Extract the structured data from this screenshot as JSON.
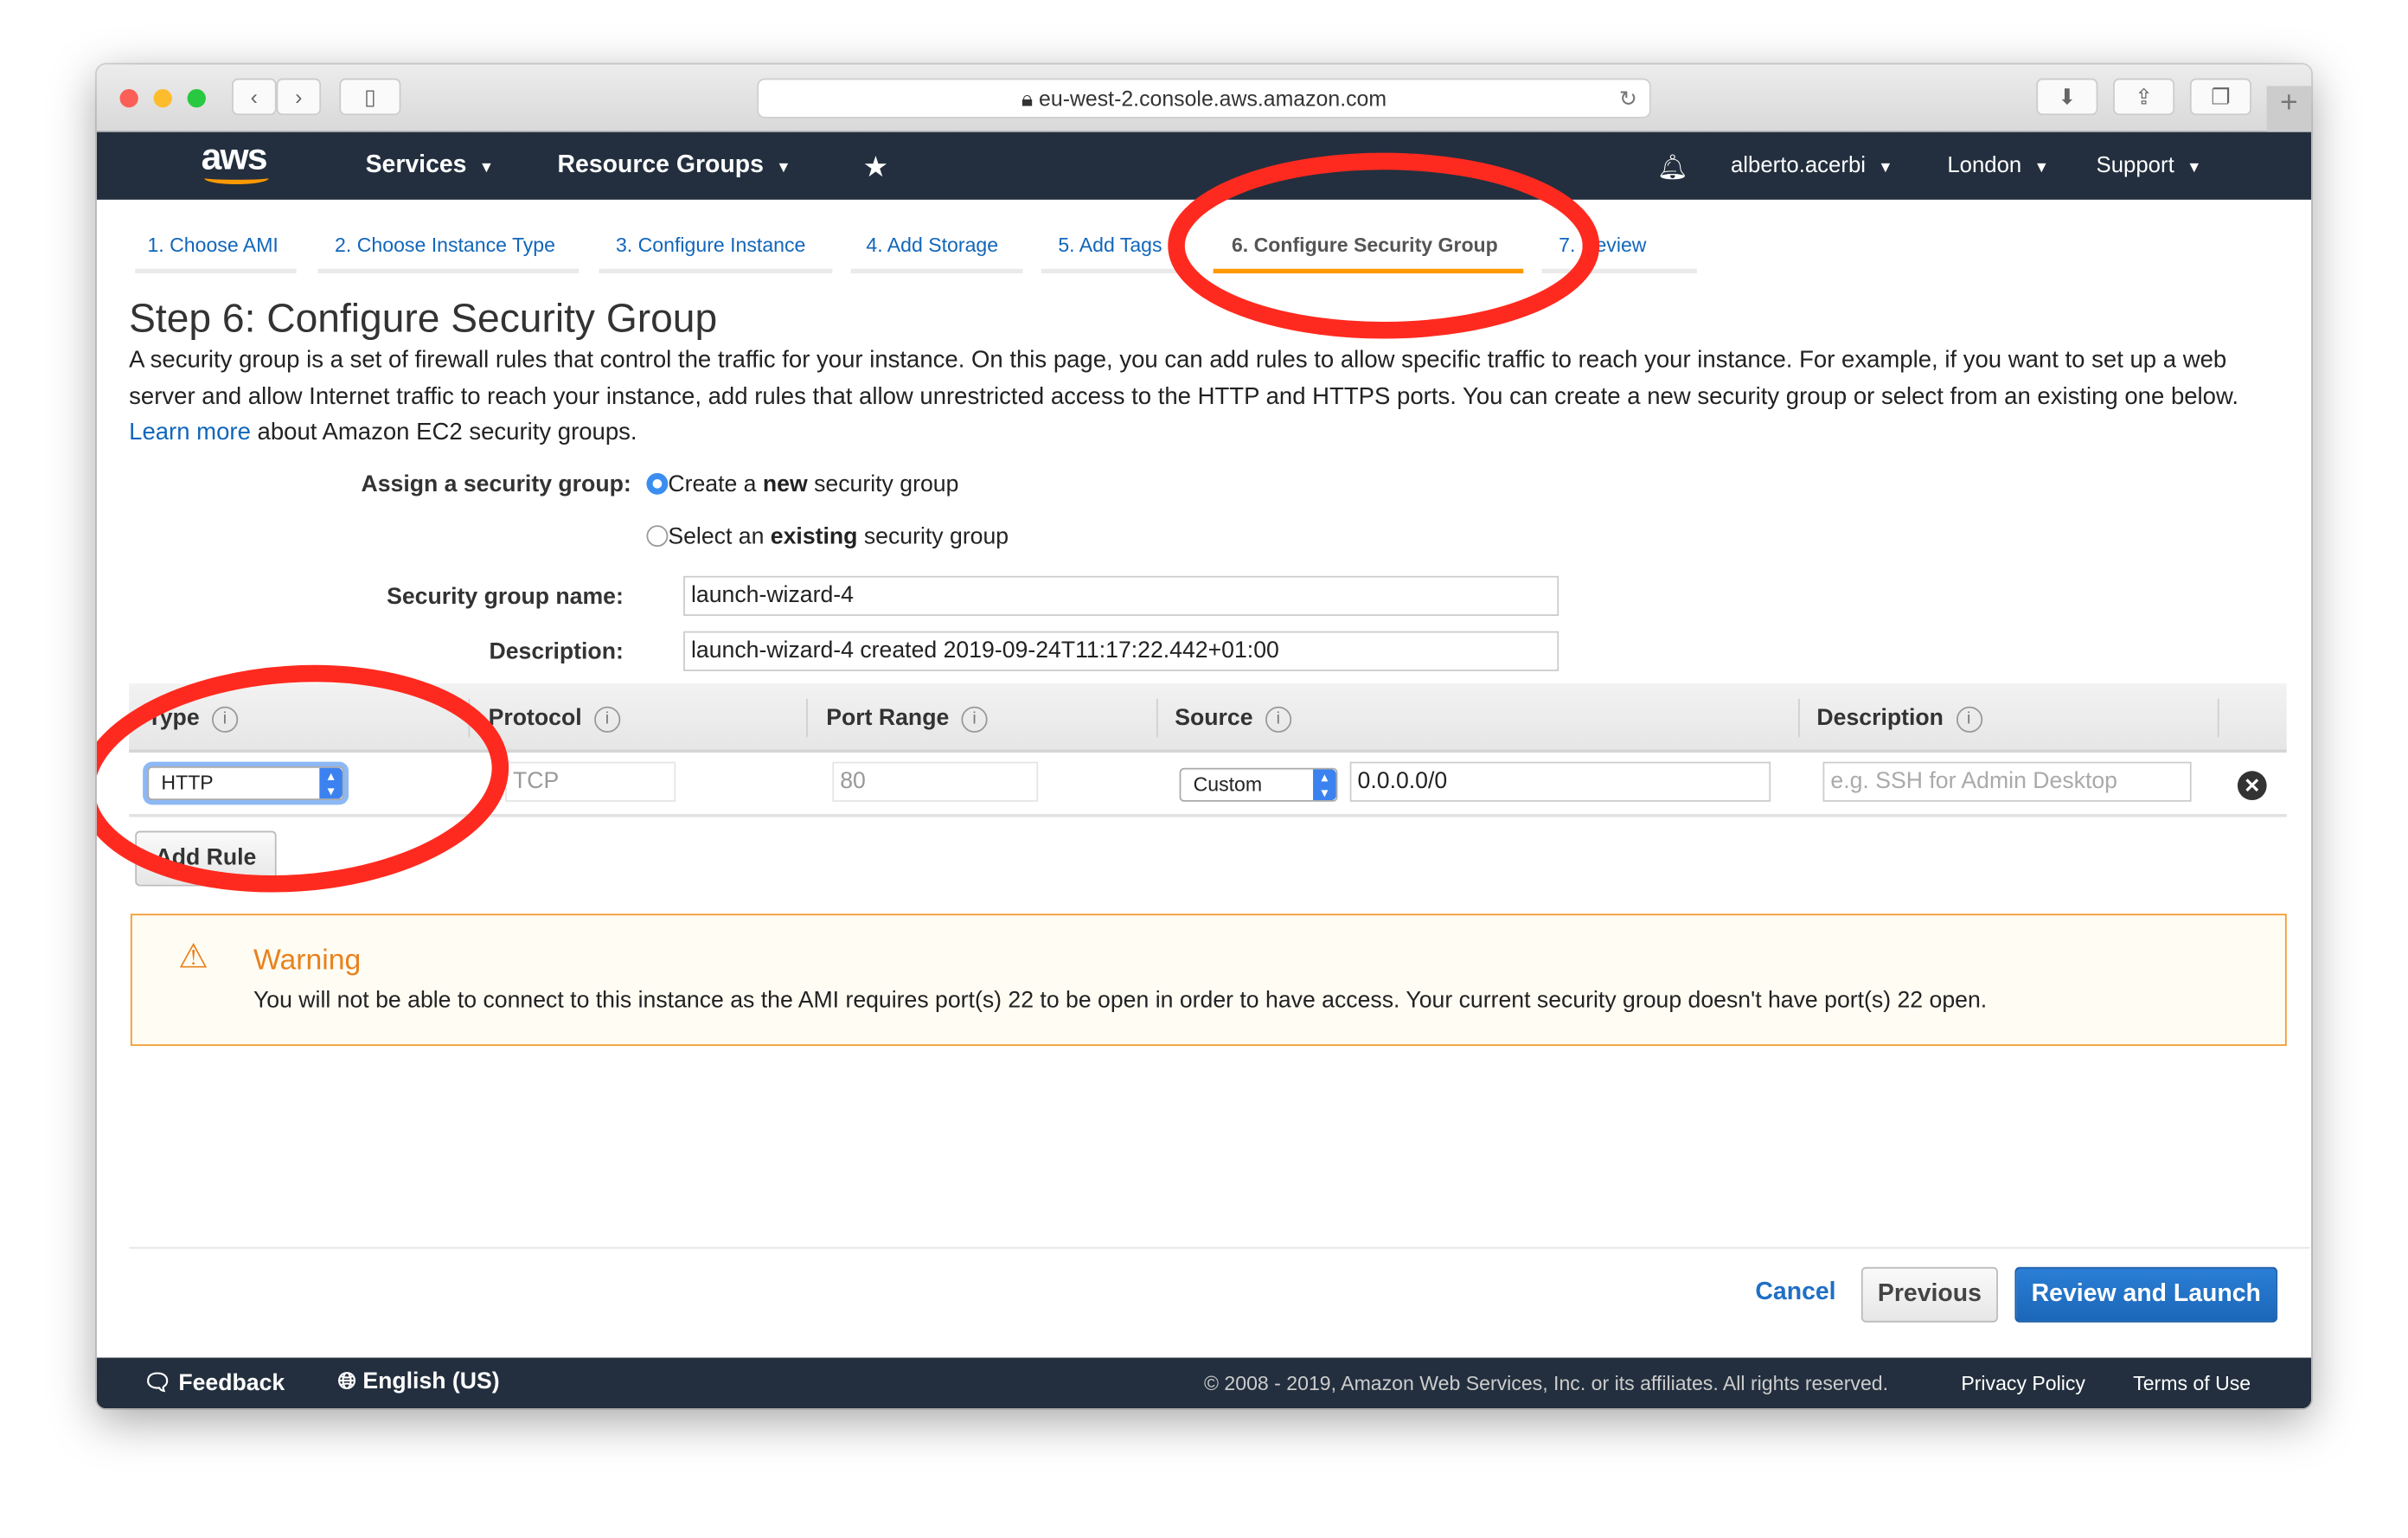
{
  "browser": {
    "url": "eu-west-2.console.aws.amazon.com"
  },
  "nav": {
    "logo": "aws",
    "services": "Services",
    "resource_groups": "Resource Groups",
    "user": "alberto.acerbi",
    "region": "London",
    "support": "Support"
  },
  "tabs": [
    {
      "label": "1. Choose AMI"
    },
    {
      "label": "2. Choose Instance Type"
    },
    {
      "label": "3. Configure Instance"
    },
    {
      "label": "4. Add Storage"
    },
    {
      "label": "5. Add Tags"
    },
    {
      "label": "6. Configure Security Group",
      "active": true
    },
    {
      "label": "7. Review"
    }
  ],
  "page": {
    "title": "Step 6: Configure Security Group",
    "intro_before": "A security group is a set of firewall rules that control the traffic for your instance. On this page, you can add rules to allow specific traffic to reach your instance. For example, if you want to set up a web server and allow Internet traffic to reach your instance, add rules that allow unrestricted access to the HTTP and HTTPS ports. You can create a new security group or select from an existing one below.",
    "learn_more": "Learn more",
    "intro_after": "about Amazon EC2 security groups."
  },
  "form": {
    "assign_label": "Assign a security group:",
    "option_new_pre": "Create a ",
    "option_new_bold": "new",
    "option_new_post": " security group",
    "option_existing_pre": "Select an ",
    "option_existing_bold": "existing",
    "option_existing_post": " security group",
    "name_label": "Security group name:",
    "name_value": "launch-wizard-4",
    "desc_label": "Description:",
    "desc_value": "launch-wizard-4 created 2019-09-24T11:17:22.442+01:00"
  },
  "table": {
    "headers": [
      "Type",
      "Protocol",
      "Port Range",
      "Source",
      "Description"
    ],
    "rows": [
      {
        "type": "HTTP",
        "protocol": "TCP",
        "port_range": "80",
        "source_mode": "Custom",
        "source": "0.0.0.0/0",
        "description_placeholder": "e.g. SSH for Admin Desktop"
      }
    ],
    "add_rule": "Add Rule"
  },
  "warning": {
    "title": "Warning",
    "text": "You will not be able to connect to this instance as the AMI requires port(s) 22 to be open in order to have access. Your current security group doesn't have port(s) 22 open."
  },
  "actions": {
    "cancel": "Cancel",
    "previous": "Previous",
    "review": "Review and Launch"
  },
  "footer": {
    "feedback": "Feedback",
    "language": "English (US)",
    "copyright": "© 2008 - 2019, Amazon Web Services, Inc. or its affiliates. All rights reserved.",
    "privacy": "Privacy Policy",
    "terms": "Terms of Use"
  },
  "colors": {
    "nav": "#232f3e",
    "accent": "#ff9900",
    "link": "#1166bb",
    "primary": "#1f6fc5",
    "annotation": "#ff2a1f"
  }
}
